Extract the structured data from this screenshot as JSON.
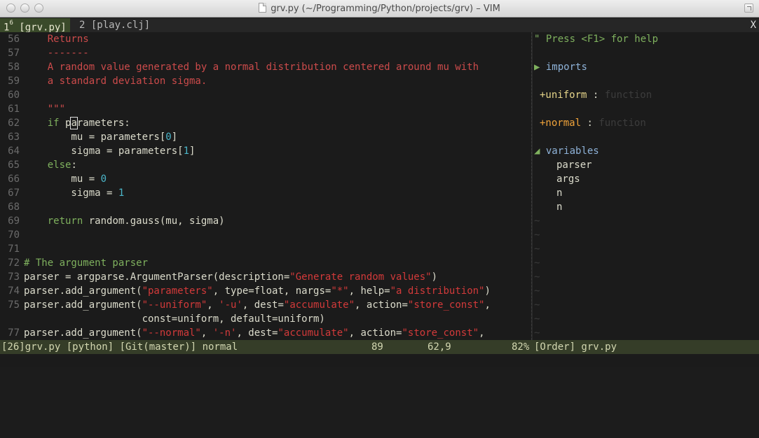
{
  "window": {
    "title": "grv.py (~/Programming/Python/projects/grv) – VIM"
  },
  "tabline": {
    "active_num": "1",
    "active_sup": "6",
    "active_name": "[grv.py]",
    "inactive_label": "2 [play.clj]",
    "close": "X"
  },
  "editor": {
    "lines": [
      {
        "n": "56",
        "parts": [
          [
            "    ",
            ""
          ],
          [
            "Returns",
            "doc"
          ]
        ]
      },
      {
        "n": "57",
        "parts": [
          [
            "    ",
            ""
          ],
          [
            "-------",
            "doc"
          ]
        ]
      },
      {
        "n": "58",
        "parts": [
          [
            "    ",
            ""
          ],
          [
            "A random value generated by a normal distribution centered around mu with",
            "doc"
          ]
        ]
      },
      {
        "n": "59",
        "parts": [
          [
            "    ",
            ""
          ],
          [
            "a standard deviation sigma.",
            "doc"
          ]
        ]
      },
      {
        "n": "60",
        "parts": []
      },
      {
        "n": "61",
        "parts": [
          [
            "    ",
            ""
          ],
          [
            "\"\"\"",
            "doc"
          ]
        ]
      },
      {
        "n": "62",
        "parts": [
          [
            "    ",
            ""
          ],
          [
            "if",
            "kw"
          ],
          [
            " p",
            ""
          ],
          [
            "a",
            "cursor"
          ],
          [
            "rameters:",
            ""
          ]
        ]
      },
      {
        "n": "63",
        "parts": [
          [
            "        mu = parameters[",
            ""
          ],
          [
            "0",
            "num"
          ],
          [
            "]",
            ""
          ]
        ]
      },
      {
        "n": "64",
        "parts": [
          [
            "        sigma = parameters[",
            ""
          ],
          [
            "1",
            "num"
          ],
          [
            "]",
            ""
          ]
        ]
      },
      {
        "n": "65",
        "parts": [
          [
            "    ",
            ""
          ],
          [
            "else",
            "kw"
          ],
          [
            ":",
            ""
          ]
        ]
      },
      {
        "n": "66",
        "parts": [
          [
            "        mu = ",
            ""
          ],
          [
            "0",
            "num"
          ]
        ]
      },
      {
        "n": "67",
        "parts": [
          [
            "        sigma = ",
            ""
          ],
          [
            "1",
            "num"
          ]
        ]
      },
      {
        "n": "68",
        "parts": []
      },
      {
        "n": "69",
        "parts": [
          [
            "    ",
            ""
          ],
          [
            "return",
            "kw"
          ],
          [
            " random.gauss(mu, sigma)",
            ""
          ]
        ]
      },
      {
        "n": "70",
        "parts": []
      },
      {
        "n": "71",
        "parts": []
      },
      {
        "n": "72",
        "parts": [
          [
            "# The argument parser",
            "cmt"
          ]
        ]
      },
      {
        "n": "73",
        "parts": [
          [
            "parser = argparse.ArgumentParser(description=",
            ""
          ],
          [
            "\"Generate random values\"",
            "str"
          ],
          [
            ")",
            ""
          ]
        ]
      },
      {
        "n": "74",
        "parts": [
          [
            "parser.add_argument(",
            ""
          ],
          [
            "\"parameters\"",
            "str"
          ],
          [
            ", type=float, nargs=",
            ""
          ],
          [
            "\"*\"",
            "str"
          ],
          [
            ", help=",
            ""
          ],
          [
            "\"a distribution\"",
            "str"
          ],
          [
            ")",
            ""
          ]
        ]
      },
      {
        "n": "75",
        "parts": [
          [
            "parser.add_argument(",
            ""
          ],
          [
            "\"--uniform\"",
            "str"
          ],
          [
            ", ",
            ""
          ],
          [
            "'-u'",
            "str"
          ],
          [
            ", dest=",
            ""
          ],
          [
            "\"accumulate\"",
            "str"
          ],
          [
            ", action=",
            ""
          ],
          [
            "\"store_const\"",
            "str"
          ],
          [
            ",",
            ""
          ]
        ]
      },
      {
        "n": "",
        "parts": [
          [
            "                    const=uniform, default=uniform)",
            ""
          ]
        ]
      },
      {
        "n": "77",
        "parts": [
          [
            "parser.add_argument(",
            ""
          ],
          [
            "\"--normal\"",
            "str"
          ],
          [
            ", ",
            ""
          ],
          [
            "'-n'",
            "str"
          ],
          [
            ", dest=",
            ""
          ],
          [
            "\"accumulate\"",
            "str"
          ],
          [
            ", action=",
            ""
          ],
          [
            "\"store_const\"",
            "str"
          ],
          [
            ",",
            ""
          ]
        ]
      }
    ]
  },
  "tagbar": {
    "help": "\" Press <F1> for help",
    "imports_label": "imports",
    "uniform_name": "+uniform",
    "uniform_sep": " : ",
    "uniform_type": "function",
    "normal_name": "+normal",
    "normal_sep": " : ",
    "normal_type": "function",
    "variables_label": "variables",
    "variables": [
      "parser",
      "args",
      "n",
      "n"
    ],
    "tilde": "~"
  },
  "statusbar": {
    "left": "[26]grv.py [python] [Git(master)] normal",
    "count": "89",
    "position": "62,9",
    "percent": "82%",
    "right": "[Order] grv.py"
  }
}
